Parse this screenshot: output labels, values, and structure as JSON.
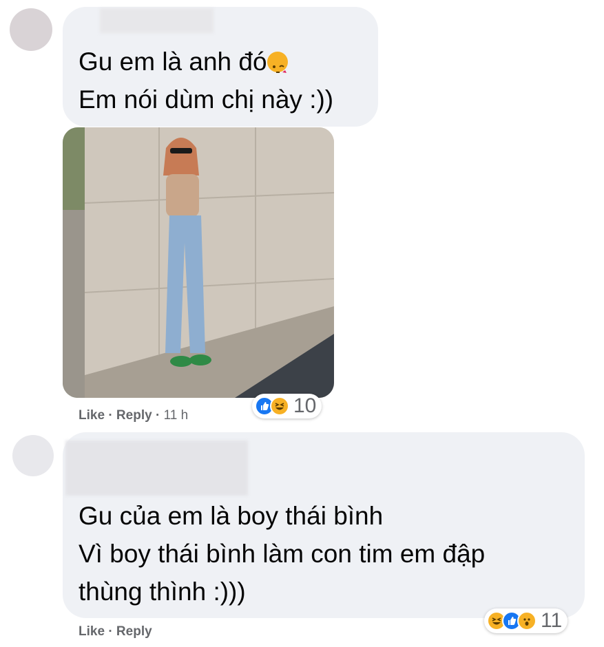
{
  "comment1": {
    "lines": [
      "Gu em là anh đó",
      "Em nói dùm chị này :))"
    ],
    "emoji": "kiss-emoji",
    "actions": {
      "like": "Like",
      "reply": "Reply",
      "time": "11 h"
    },
    "reaction_count": "10"
  },
  "comment2": {
    "lines": [
      "Gu của em là boy thái bình",
      "Vì boy thái bình làm con tim em đập",
      "thùng thình :)))"
    ],
    "actions": {
      "like": "Like",
      "reply": "Reply"
    },
    "reaction_count": "11"
  },
  "separator": "·",
  "colors": {
    "bubble": "#eff1f5",
    "meta": "#65676b",
    "like_blue": "#1877f2",
    "emoji_yellow": "#f7b125"
  }
}
